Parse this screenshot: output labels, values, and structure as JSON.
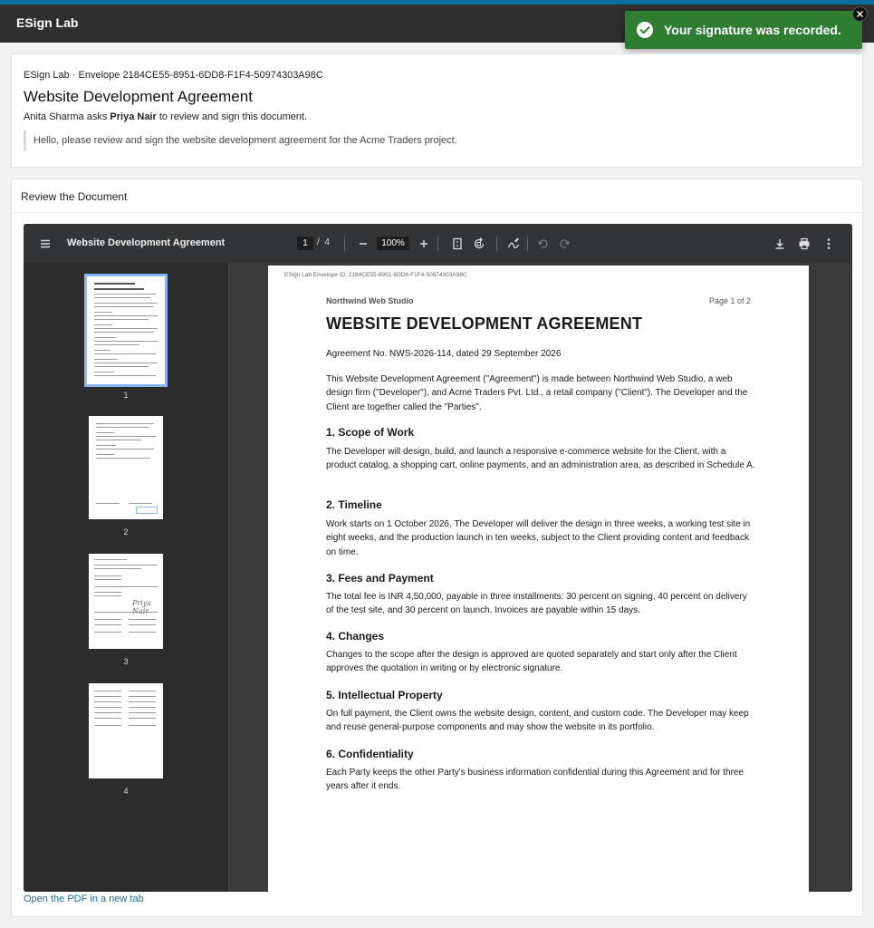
{
  "header": {
    "app_title": "ESign Lab",
    "accent_color": "#0b6e99",
    "bar_color": "#2f2f2f"
  },
  "toast": {
    "message": "Your signature was recorded.",
    "icon": "check-circle-icon",
    "close_icon": "close-icon",
    "color": "#2e7d32"
  },
  "envelope": {
    "line": "ESign Lab · Envelope 2184CE55-8951-6DD8-F1F4-50974303A98C",
    "title": "Website Development Agreement",
    "sender": "Anita Sharma",
    "ask_prefix": "asks",
    "signer": "Priya Nair",
    "ask_suffix": "to review and sign this document.",
    "message": "Hello, please review and sign the website development agreement for the Acme Traders project."
  },
  "review": {
    "heading": "Review the Document",
    "open_link": "Open the PDF in a new tab"
  },
  "viewer": {
    "menu_icon": "menu-icon",
    "title": "Website Development Agreement",
    "current_page": "1",
    "page_separator": "/",
    "total_pages": "4",
    "zoom": "100%",
    "toolbar_icons": [
      "zoom-out-icon",
      "zoom-in-icon",
      "fit-page-icon",
      "rotate-icon",
      "annotate-icon",
      "undo-icon",
      "redo-icon",
      "download-icon",
      "print-icon",
      "more-vert-icon"
    ],
    "thumbnails": [
      {
        "label": "1",
        "selected": true
      },
      {
        "label": "2",
        "selected": false
      },
      {
        "label": "3",
        "selected": false
      },
      {
        "label": "4",
        "selected": false
      }
    ]
  },
  "page": {
    "envelope_id": "ESign Lab Envelope ID: 2184CE55-8951-6DD8-F1F4-50974303A98C",
    "company": "Northwind Web Studio",
    "page_of": "Page 1 of 2",
    "title": "WEBSITE DEVELOPMENT AGREEMENT",
    "agreement_no": "Agreement No. NWS-2026-114, dated 29 September 2026",
    "intro": "This Website Development Agreement (\"Agreement\") is made between Northwind Web Studio, a web design firm (\"Developer\"), and Acme Traders Pvt. Ltd., a retail company (\"Client\"). The Developer and the Client are together called the \"Parties\".",
    "sections": [
      {
        "heading": "1. Scope of Work",
        "body": "The Developer will design, build, and launch a responsive e-commerce website for the Client, with a product catalog, a shopping cart, online payments, and an administration area, as described in Schedule A."
      },
      {
        "heading": "2. Timeline",
        "body": "Work starts on 1 October 2026. The Developer will deliver the design in three weeks, a working test site in eight weeks, and the production launch in ten weeks, subject to the Client providing content and feedback on time."
      },
      {
        "heading": "3. Fees and Payment",
        "body": "The total fee is INR 4,50,000, payable in three installments: 30 percent on signing, 40 percent on delivery of the test site, and 30 percent on launch. Invoices are payable within 15 days."
      },
      {
        "heading": "4. Changes",
        "body": "Changes to the scope after the design is approved are quoted separately and start only after the Client approves the quotation in writing or by electronic signature."
      },
      {
        "heading": "5. Intellectual Property",
        "body": "On full payment, the Client owns the website design, content, and custom code. The Developer may keep and reuse general-purpose components and may show the website in its portfolio."
      },
      {
        "heading": "6. Confidentiality",
        "body": "Each Party keeps the other Party's business information confidential during this Agreement and for three years after it ends."
      }
    ]
  }
}
